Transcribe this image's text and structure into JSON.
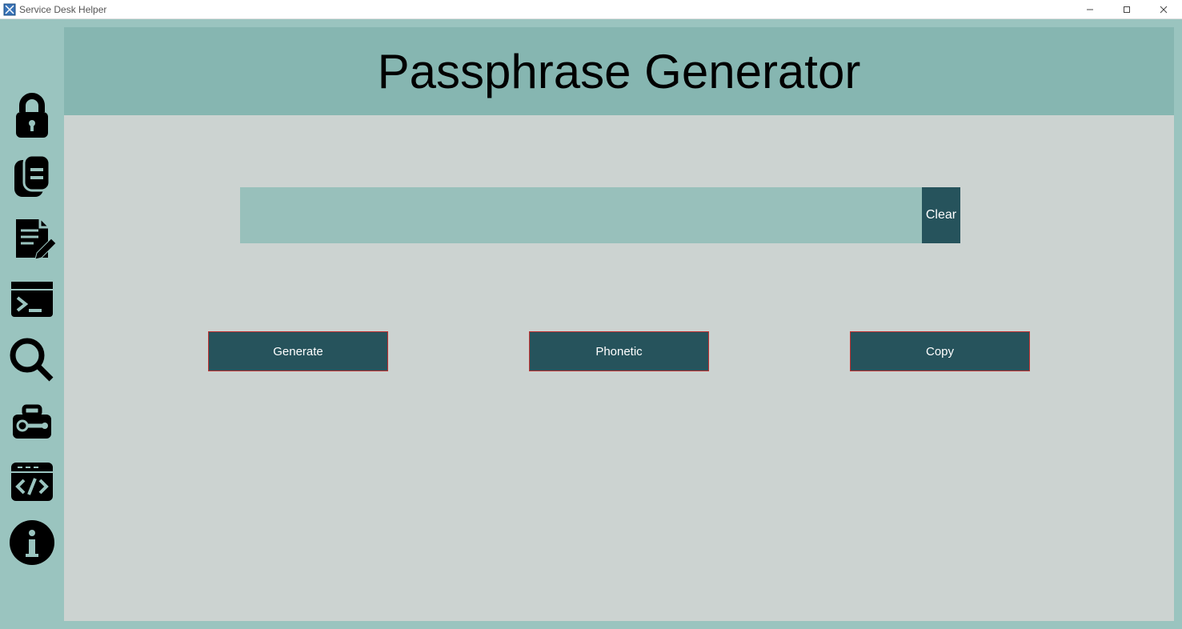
{
  "window": {
    "title": "Service Desk Helper"
  },
  "sidebar": {
    "icons": [
      "lock-icon",
      "clipboard-icon",
      "edit-note-icon",
      "terminal-icon",
      "search-icon",
      "toolbox-icon",
      "code-icon",
      "info-icon"
    ]
  },
  "header": {
    "title": "Passphrase Generator"
  },
  "passphrase": {
    "value": "",
    "clear_label": "Clear"
  },
  "buttons": {
    "generate": "Generate",
    "phonetic": "Phonetic",
    "copy": "Copy"
  },
  "colors": {
    "sidebar_bg": "#9ac4bf",
    "main_bg": "#ccd3d1",
    "banner_bg": "#86b6b1",
    "button_bg": "#26535c",
    "button_border": "#c03030",
    "input_bg": "#98c0bb"
  }
}
